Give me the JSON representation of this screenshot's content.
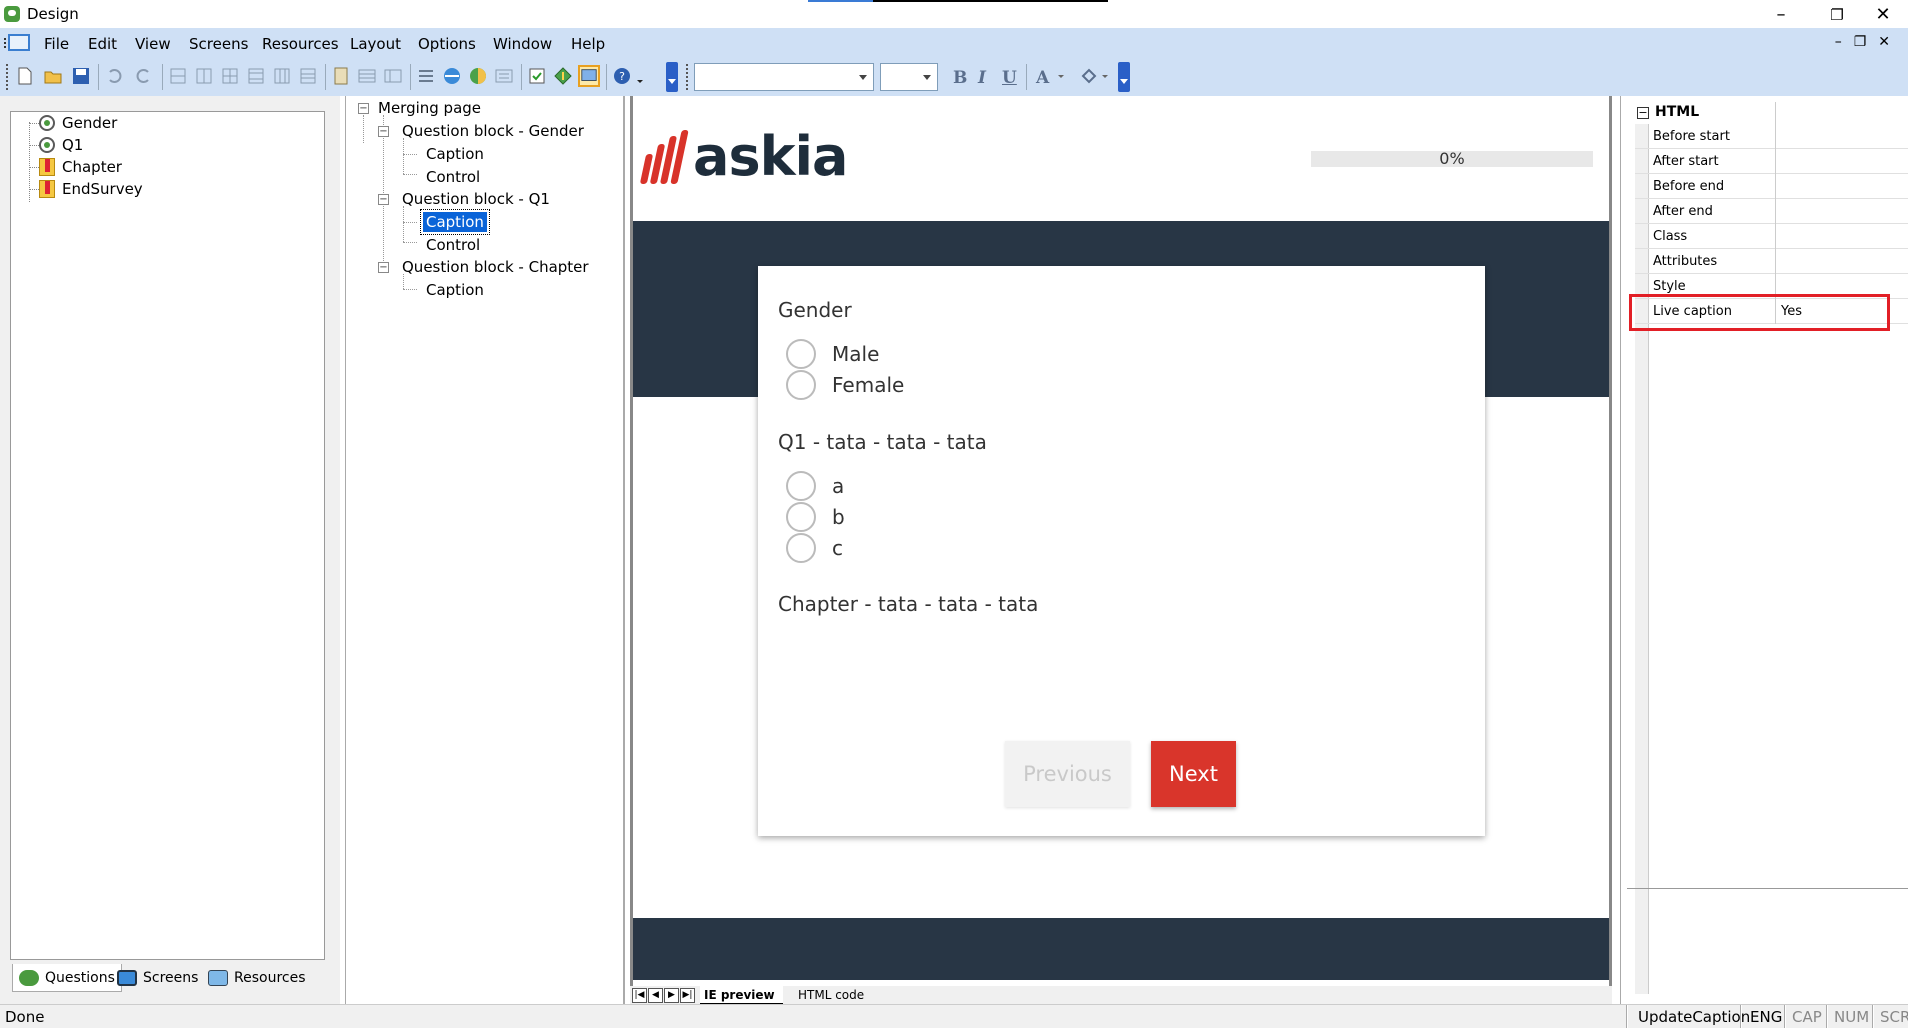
{
  "window": {
    "title": "Design",
    "minimize": "–",
    "restore": "❐",
    "close": "✕"
  },
  "menu": [
    "File",
    "Edit",
    "View",
    "Screens",
    "Resources",
    "Layout",
    "Options",
    "Window",
    "Help"
  ],
  "mdi_controls": "–❐✕",
  "left_tree": {
    "items": [
      {
        "label": "Gender",
        "icon": "radio-question-icon"
      },
      {
        "label": "Q1",
        "icon": "radio-question-icon"
      },
      {
        "label": "Chapter",
        "icon": "chapter-icon"
      },
      {
        "label": "EndSurvey",
        "icon": "chapter-icon"
      }
    ]
  },
  "left_tabs": {
    "questions": "Questions",
    "screens": "Screens",
    "resources": "Resources"
  },
  "structure_tree": {
    "root": "Merging page",
    "blocks": [
      {
        "label": "Question block - Gender",
        "children": [
          "Caption",
          "Control"
        ]
      },
      {
        "label": "Question block - Q1",
        "children": [
          "Caption",
          "Control"
        ]
      },
      {
        "label": "Question block - Chapter",
        "children": [
          "Caption"
        ]
      }
    ],
    "selected": "Caption"
  },
  "preview": {
    "logo_text": "askia",
    "progress_text": "0%",
    "progress_value": 0,
    "questions": [
      {
        "caption": "Gender",
        "options": [
          "Male",
          "Female"
        ]
      },
      {
        "caption": "Q1 - tata - tata - tata",
        "options": [
          "a",
          "b",
          "c"
        ]
      },
      {
        "caption": "Chapter - tata - tata - tata",
        "options": []
      }
    ],
    "previous_label": "Previous",
    "next_label": "Next"
  },
  "preview_tabs": {
    "ie_preview": "IE preview",
    "html_code": "HTML code"
  },
  "properties": {
    "section": "HTML",
    "rows": [
      {
        "key": "Before start",
        "value": ""
      },
      {
        "key": "After start",
        "value": ""
      },
      {
        "key": "Before end",
        "value": ""
      },
      {
        "key": "After end",
        "value": ""
      },
      {
        "key": "Class",
        "value": ""
      },
      {
        "key": "Attributes",
        "value": ""
      },
      {
        "key": "Style",
        "value": ""
      },
      {
        "key": "Live caption",
        "value": "Yes"
      }
    ]
  },
  "statusbar": {
    "left": "Done",
    "action": "UpdateCaption",
    "lang": "ENG",
    "cap": "CAP",
    "num": "NUM",
    "scr": "SCRL"
  },
  "colors": {
    "accent_red": "#d9352b",
    "dark_band": "#283645",
    "menu_bg": "#cfe0f5",
    "highlight": "#e21f26"
  }
}
